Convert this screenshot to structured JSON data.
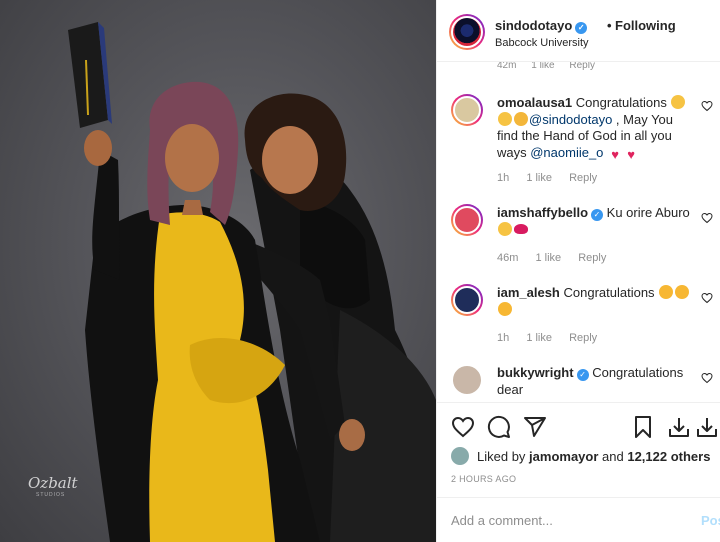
{
  "header": {
    "username": "sindodotayo",
    "verified": true,
    "separator": "•",
    "follow_label": "Following",
    "location": "Babcock University"
  },
  "photo": {
    "watermark": "Ozbalt",
    "watermark_sub": "STUDIOS"
  },
  "comments": {
    "partial_previous": {
      "time": "42m",
      "likes": "1 like",
      "reply": "Reply"
    },
    "items": [
      {
        "username": "omoalausa1",
        "text_parts": [
          "Congratulations",
          "@sindodotayo",
          " , May You find the Hand of God in all you ways ",
          "@naomiie_o"
        ],
        "time": "1h",
        "likes": "1 like",
        "reply": "Reply",
        "avatar_color": "#d9c8a0"
      },
      {
        "username": "iamshaffybello",
        "verified": true,
        "text_parts": [
          "Ku orire Aburo"
        ],
        "time": "46m",
        "likes": "1 like",
        "reply": "Reply",
        "avatar_color": "#e04a5f"
      },
      {
        "username": "iam_alesh",
        "text_parts": [
          "Congratulations"
        ],
        "time": "1h",
        "likes": "1 like",
        "reply": "Reply",
        "avatar_color": "#1f2d5a"
      },
      {
        "username": "bukkywright",
        "verified": true,
        "text_parts": [
          "Congratulations dear"
        ],
        "avatar_color": "#c9b7a8"
      }
    ]
  },
  "actions": {
    "icons": [
      "heart-icon",
      "comment-icon",
      "share-icon",
      "bookmark-icon",
      "download-icon",
      "download-alt-icon"
    ],
    "liked_by_prefix": "Liked by ",
    "liked_by_user": "jamomayor",
    "liked_by_conjunction": " and ",
    "liked_by_count": "12,122 others",
    "timestamp": "2 HOURS AGO"
  },
  "add_comment": {
    "placeholder": "Add a comment...",
    "post_label": "Post"
  },
  "colors": {
    "accent_blue": "#3897f0",
    "post_disabled": "#b2dffc",
    "meta_gray": "#8e8e8e",
    "dress_yellow": "#e9b81a"
  }
}
